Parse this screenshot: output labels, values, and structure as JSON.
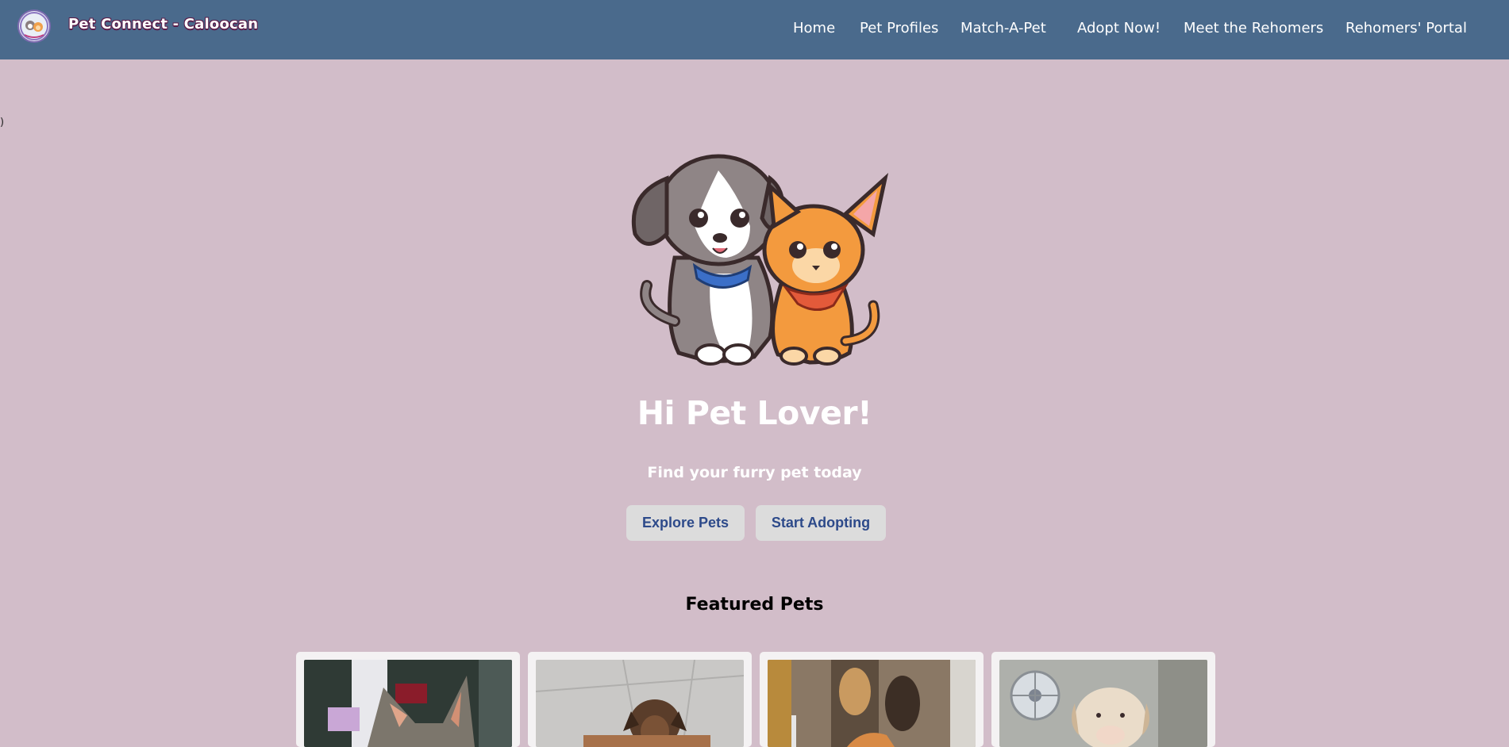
{
  "header": {
    "brand_title": "Pet Connect - Caloocan",
    "logo_icon": "pet-connect-logo-icon"
  },
  "nav": {
    "items": [
      {
        "label": "Home"
      },
      {
        "label": "Pet Profiles"
      },
      {
        "label": "Match-A-Pet"
      },
      {
        "label": "Adopt Now!"
      },
      {
        "label": "Meet the Rehomers"
      },
      {
        "label": "Rehomers' Portal"
      }
    ]
  },
  "stray_glyph": ")",
  "hero": {
    "illustration": "dog-and-cat-illustration",
    "title": "Hi Pet Lover!",
    "subtitle": "Find your furry pet today",
    "buttons": {
      "explore": "Explore Pets",
      "adopt": "Start Adopting"
    }
  },
  "featured": {
    "heading": "Featured Pets",
    "cards": [
      {
        "photo": "cat-photo"
      },
      {
        "photo": "brown-puppy-photo"
      },
      {
        "photo": "orange-cat-photo"
      },
      {
        "photo": "white-puppy-photo"
      }
    ]
  },
  "colors": {
    "navbar": "#4a6a8c",
    "page_background": "#d2bdc9",
    "button_background": "#dcdcdc",
    "button_text": "#2d4a8a"
  }
}
